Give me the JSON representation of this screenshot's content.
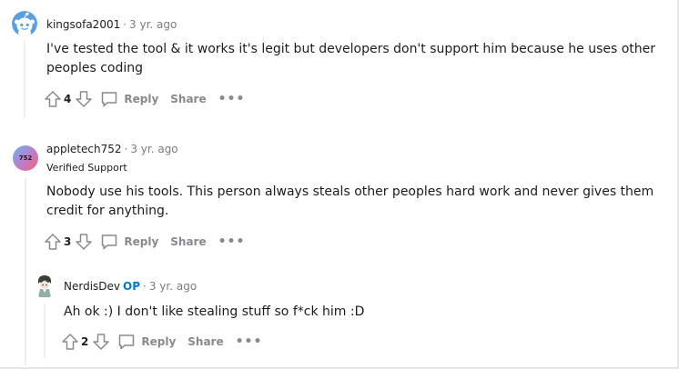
{
  "comments": [
    {
      "username": "kingsofa2001",
      "time": "3 yr. ago",
      "body_line1": "I've tested the tool & it works it's legit but developers don't support him because he uses other",
      "body_line2": "peoples coding",
      "score": "4",
      "reply_label": "Reply",
      "share_label": "Share",
      "more_label": "•••",
      "avatar_icon": "snoo-avatar-icon"
    },
    {
      "username": "appletech752",
      "time": "3 yr. ago",
      "flair": "Verified Support",
      "avatar_text": "752",
      "body_line1": "Nobody use his tools. This person always steals other peoples hard work and never gives them",
      "body_line2": "credit for anything.",
      "score": "3",
      "reply_label": "Reply",
      "share_label": "Share",
      "more_label": "•••"
    },
    {
      "username": "NerdisDev",
      "op_label": "OP",
      "time": "3 yr. ago",
      "body_line1": "Ah ok :) I don't like stealing stuff so f*ck him :D",
      "score": "2",
      "reply_label": "Reply",
      "share_label": "Share",
      "more_label": "•••",
      "avatar_icon": "anime-character-avatar-icon"
    }
  ],
  "separator_dot": "·",
  "colors": {
    "op": "#0079d3",
    "meta_gray": "#7c7c7c",
    "action_gray": "#878a8c",
    "thread_line": "#edeff1",
    "snoo_blue": "#5a9fe0"
  }
}
